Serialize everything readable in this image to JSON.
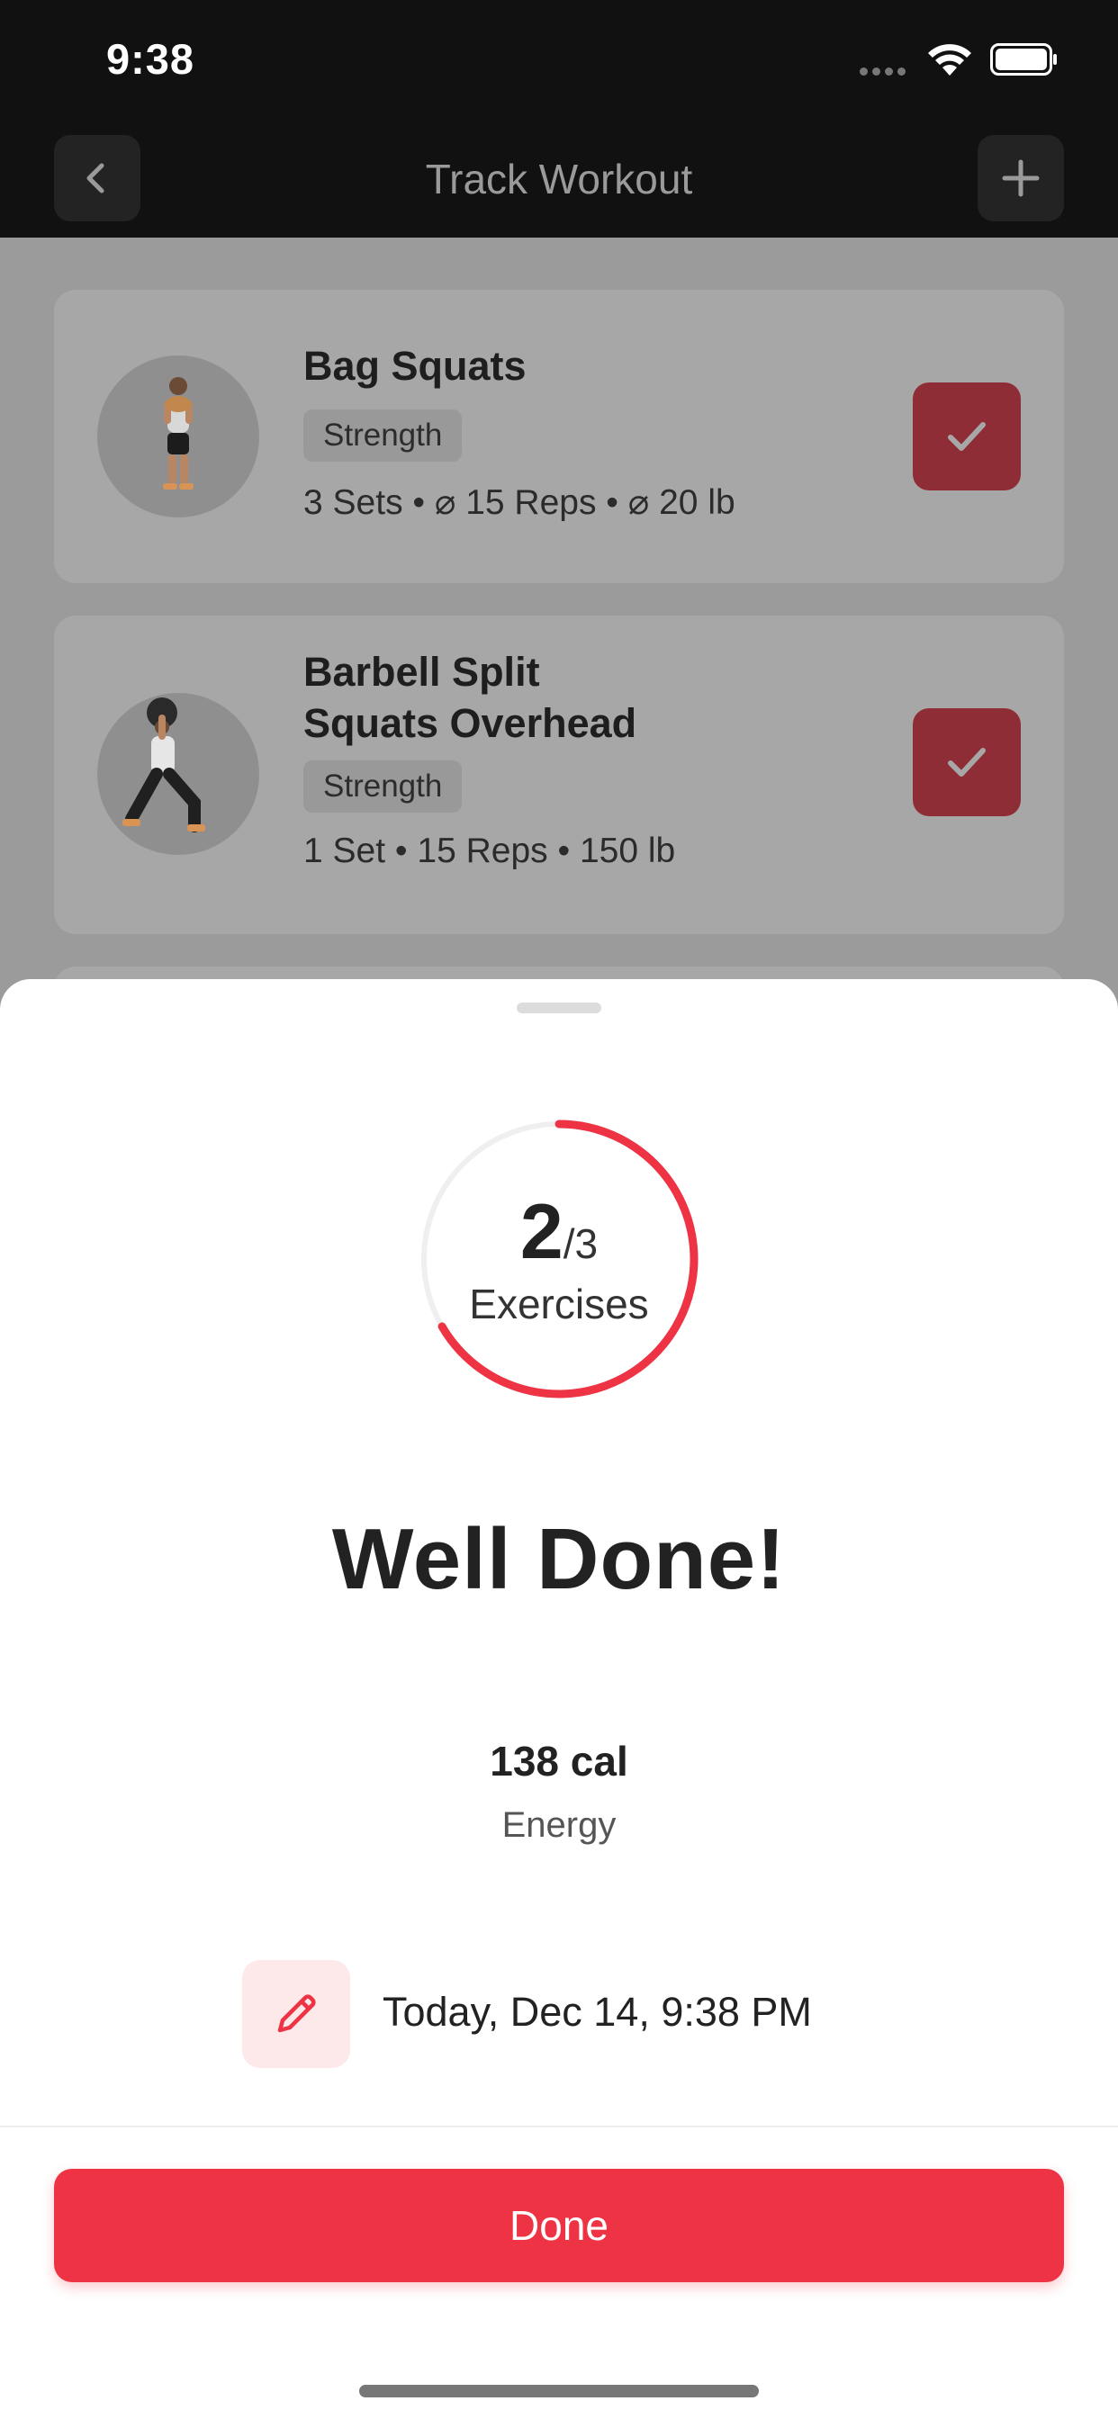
{
  "status_bar": {
    "time": "9:38"
  },
  "nav": {
    "title": "Track Workout"
  },
  "exercises": [
    {
      "title_lines": [
        "Bag Squats"
      ],
      "category": "Strength",
      "meta": "3 Sets • ⌀ 15 Reps • ⌀ 20 lb",
      "completed": true
    },
    {
      "title_lines": [
        "Barbell Split",
        "Squats Overhead"
      ],
      "category": "Strength",
      "meta": "1 Set • 15 Reps • 150 lb",
      "completed": true
    }
  ],
  "summary": {
    "completed": "2",
    "total": "/3",
    "progress_fraction": 0.6667,
    "unit_label": "Exercises",
    "headline": "Well Done!",
    "energy_value": "138 cal",
    "energy_label": "Energy",
    "date_text": "Today, Dec 14, 9:38 PM",
    "done_label": "Done"
  },
  "colors": {
    "accent": "#ee3344",
    "accent_light": "#fde9ea",
    "dim_overlay": "#9b9b9b"
  }
}
